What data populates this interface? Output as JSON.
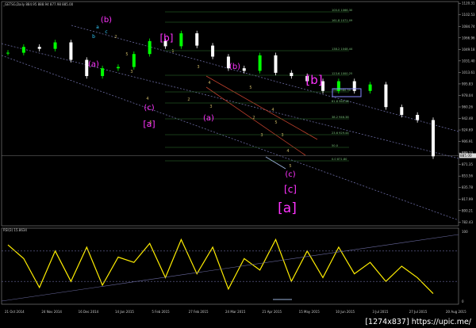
{
  "header": {
    "title": "_GETSG,Daily  884.95 888.94 877.98 885.00",
    "rsi_title": "RSI(3) 15.8634"
  },
  "watermark": "[1274x837] https://upic.me/",
  "colors": {
    "bg": "#000000",
    "bull": "#00ff00",
    "bear": "#ffffff",
    "wave_magenta": "#ff33ff",
    "wave_cyan": "#33ccff",
    "minor": "#c8b464",
    "rsi": "#ffee00",
    "channel": "#6a6aa0",
    "fib": "#2f7a2f"
  },
  "chart_data": [
    {
      "type": "candlestick",
      "title": "_GETSG,Daily",
      "ylim": [
        776.7,
        1123
      ],
      "y_ticks": [
        "1120.31",
        "1102.53",
        "1084.74",
        "1066.96",
        "1049.18",
        "1031.40",
        "1013.61",
        "995.83",
        "978.04",
        "960.26",
        "942.48",
        "924.69",
        "906.91",
        "889.13",
        "871.35",
        "853.56",
        "835.78",
        "817.99",
        "800.21",
        "782.43"
      ],
      "x_ticks": [
        "21 Oct 2014",
        "24 Nov 2014",
        "16 Dec 2014",
        "14 Jan 2015",
        "5 Feb 2015",
        "27 Feb 2015",
        "24 Mar 2015",
        "21 Apr 2015",
        "15 May 2015",
        "10 Jun 2015",
        "3 Jul 2015",
        "27 Jul 2015",
        "20 Aug 2015"
      ],
      "current_price": "885.00",
      "x": [
        "2014-10-21",
        "2014-10-31",
        "2014-11-10",
        "2014-11-24",
        "2014-12-01",
        "2014-12-08",
        "2014-12-16",
        "2014-12-24",
        "2015-01-05",
        "2015-01-14",
        "2015-01-23",
        "2015-02-05",
        "2015-02-16",
        "2015-02-27",
        "2015-03-10",
        "2015-03-24",
        "2015-04-06",
        "2015-04-21",
        "2015-05-04",
        "2015-05-15",
        "2015-05-28",
        "2015-06-10",
        "2015-06-22",
        "2015-07-03",
        "2015-07-15",
        "2015-07-27",
        "2015-08-07",
        "2015-08-20"
      ],
      "close": [
        1044,
        1053,
        1050,
        1060,
        1033,
        1008,
        1020,
        1022,
        1042,
        1062,
        1054,
        1074,
        1055,
        1038,
        1020,
        1016,
        1040,
        1013,
        1008,
        1000,
        985,
        1000,
        985,
        995,
        960,
        948,
        940,
        884
      ],
      "series": [
        {
          "name": "RSI(3)",
          "values": [
            78,
            60,
            22,
            70,
            30,
            75,
            25,
            62,
            55,
            80,
            35,
            85,
            40,
            75,
            20,
            60,
            45,
            85,
            30,
            70,
            35,
            75,
            40,
            55,
            30,
            50,
            35,
            14
          ]
        }
      ],
      "fibonacci_levels": [
        "100.0  1066.30",
        "161.8  1071.09",
        "138.2  1048.44",
        "123.6  1000.25",
        "100.0  980.30",
        "61.8  960.46",
        "38.2  946.38",
        "23.6  929.44",
        "50.0",
        "0.0  871.80"
      ],
      "wave_labels": {
        "magenta": [
          "(b)",
          "(a)",
          "[b]",
          "(c)",
          "[a]",
          "(b)",
          "(a)",
          "[b]",
          "(c)",
          "[c]",
          "[a]"
        ],
        "cyan": [
          "a",
          "c",
          "b"
        ],
        "minor": [
          "2",
          "5",
          "3",
          "4",
          "5",
          "1",
          "2",
          "3",
          "4",
          "3",
          "5",
          "4",
          "3",
          "2",
          "5",
          "3",
          "4",
          "5"
        ]
      }
    }
  ]
}
